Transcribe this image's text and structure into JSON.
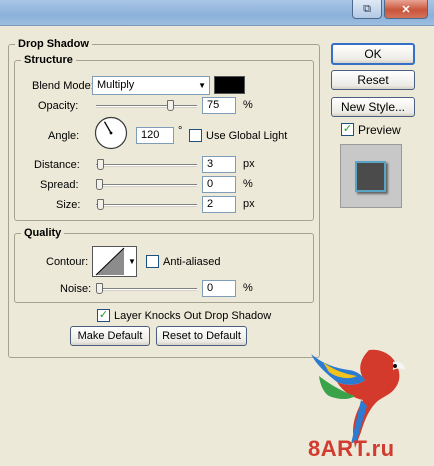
{
  "window": {
    "restore_glyph": "⧉",
    "close_glyph": "✕"
  },
  "drop_shadow": {
    "title": "Drop Shadow",
    "structure": {
      "title": "Structure",
      "blend_mode_label": "Blend Mode:",
      "blend_mode_value": "Multiply",
      "shadow_color": "#000000",
      "opacity_label": "Opacity:",
      "opacity_value": "75",
      "opacity_fraction": 0.75,
      "opacity_unit": "%",
      "angle_label": "Angle:",
      "angle_value": "120",
      "angle_unit": "°",
      "use_global_light_label": "Use Global Light",
      "use_global_light_checked": false,
      "distance_label": "Distance:",
      "distance_value": "3",
      "distance_unit": "px",
      "spread_label": "Spread:",
      "spread_value": "0",
      "spread_unit": "%",
      "size_label": "Size:",
      "size_value": "2",
      "size_unit": "px"
    },
    "quality": {
      "title": "Quality",
      "contour_label": "Contour:",
      "anti_aliased_label": "Anti-aliased",
      "anti_aliased_checked": false,
      "noise_label": "Noise:",
      "noise_value": "0",
      "noise_unit": "%"
    },
    "knocks_out_label": "Layer Knocks Out Drop Shadow",
    "knocks_out_checked": true,
    "make_default_label": "Make Default",
    "reset_default_label": "Reset to Default"
  },
  "side": {
    "ok_label": "OK",
    "reset_label": "Reset",
    "new_style_label": "New Style...",
    "preview_label": "Preview",
    "preview_checked": true
  },
  "watermark": {
    "text": "8ART.ru"
  }
}
